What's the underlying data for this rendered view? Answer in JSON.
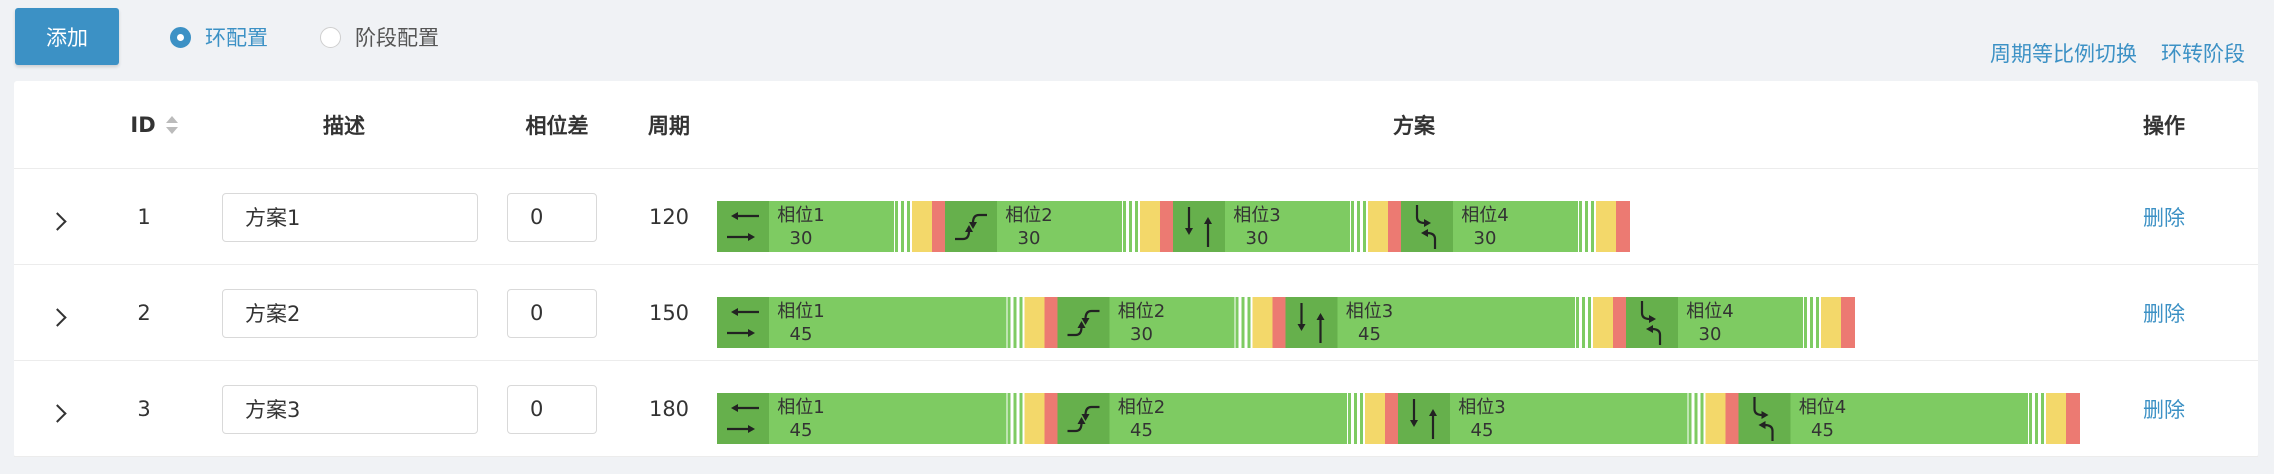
{
  "toolbar": {
    "add_label": "添加",
    "radio_ring": "环配置",
    "radio_stage": "阶段配置",
    "link_cycle": "周期等比例切换",
    "link_ring": "环转阶段"
  },
  "table": {
    "headers": {
      "id": "ID",
      "desc": "描述",
      "offset": "相位差",
      "cycle": "周期",
      "plan": "方案",
      "ops": "操作"
    },
    "delete_label": "删除",
    "rows": [
      {
        "id": "1",
        "desc": "方案1",
        "offset": "0",
        "cycle": "120",
        "phases": [
          {
            "label": "相位1",
            "time": "30",
            "icon": "east-west-through-icon"
          },
          {
            "label": "相位2",
            "time": "30",
            "icon": "left-turn-icon"
          },
          {
            "label": "相位3",
            "time": "30",
            "icon": "north-south-through-icon"
          },
          {
            "label": "相位4",
            "time": "30",
            "icon": "north-south-left-turn-icon"
          }
        ]
      },
      {
        "id": "2",
        "desc": "方案2",
        "offset": "0",
        "cycle": "150",
        "phases": [
          {
            "label": "相位1",
            "time": "45",
            "icon": "east-west-through-icon"
          },
          {
            "label": "相位2",
            "time": "30",
            "icon": "left-turn-icon"
          },
          {
            "label": "相位3",
            "time": "45",
            "icon": "north-south-through-icon"
          },
          {
            "label": "相位4",
            "time": "30",
            "icon": "north-south-left-turn-icon"
          }
        ]
      },
      {
        "id": "3",
        "desc": "方案3",
        "offset": "0",
        "cycle": "180",
        "phases": [
          {
            "label": "相位1",
            "time": "45",
            "icon": "east-west-through-icon"
          },
          {
            "label": "相位2",
            "time": "45",
            "icon": "left-turn-icon"
          },
          {
            "label": "相位3",
            "time": "45",
            "icon": "north-south-through-icon"
          },
          {
            "label": "相位4",
            "time": "45",
            "icon": "north-south-left-turn-icon"
          }
        ]
      }
    ]
  },
  "colors": {
    "accent": "#3c91c5",
    "green": "#7ecb62",
    "green_dark": "#66b04c",
    "yellow": "#f3d86a",
    "red": "#ec7a72",
    "stripe": "#7ecb62"
  }
}
